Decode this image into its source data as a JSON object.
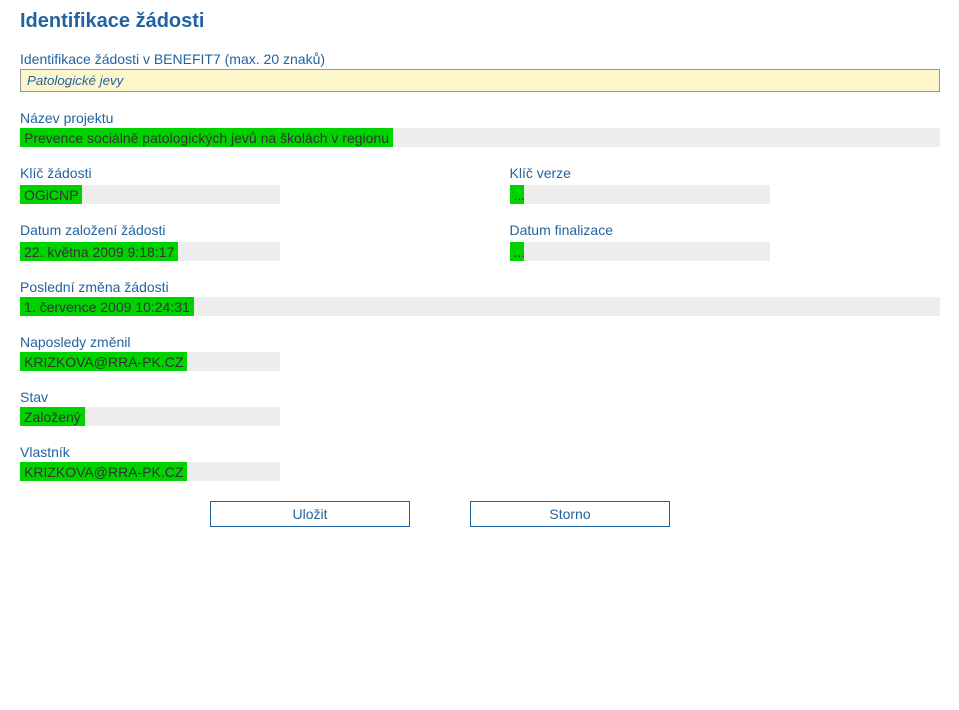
{
  "title": "Identifikace žádosti",
  "ident_label": "Identifikace žádosti v BENEFIT7 (max. 20 znaků)",
  "ident_value": "Patologické jevy",
  "project_label": "Název projektu",
  "project_value": "Prevence sociálně patologických jevů na školách v regionu",
  "key_app_label": "Klíč žádosti",
  "key_app_value": "OGiCNP",
  "key_ver_label": "Klíč verze",
  "key_ver_value": "...",
  "date_created_label": "Datum založení žádosti",
  "date_created_value": "22. května 2009 9:18:17",
  "date_final_label": "Datum finalizace",
  "date_final_value": "...",
  "last_change_label": "Poslední změna žádosti",
  "last_change_value": "1. července 2009 10:24:31",
  "last_changed_by_label": "Naposledy změnil",
  "last_changed_by_value": "KRIZKOVA@RRA-PK.CZ",
  "state_label": "Stav",
  "state_value": "Založený",
  "owner_label": "Vlastník",
  "owner_value": "KRIZKOVA@RRA-PK.CZ",
  "save_btn": "Uložit",
  "cancel_btn": "Storno"
}
